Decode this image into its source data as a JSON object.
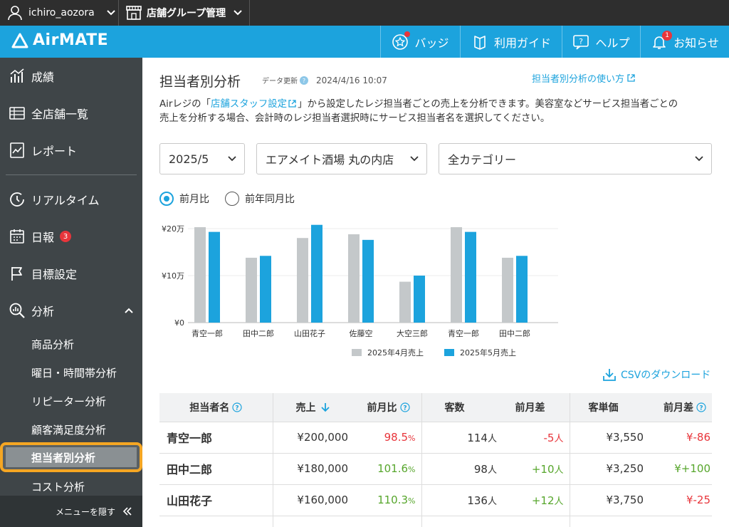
{
  "topbar": {
    "username": "ichiro_aozora",
    "store_group": "店舗グループ管理"
  },
  "header": {
    "logo": "AirMATE",
    "nav": [
      {
        "label": "バッジ",
        "icon": "badge-star-icon"
      },
      {
        "label": "利用ガイド",
        "icon": "guide-book-icon"
      },
      {
        "label": "ヘルプ",
        "icon": "help-icon"
      },
      {
        "label": "お知らせ",
        "icon": "bell-icon",
        "badge": "1"
      }
    ]
  },
  "sidebar": {
    "items": [
      {
        "label": "成績",
        "icon": "performance-chart-icon"
      },
      {
        "label": "全店舗一覧",
        "icon": "list-icon"
      },
      {
        "label": "レポート",
        "icon": "report-icon"
      },
      {
        "label": "リアルタイム",
        "icon": "clock-icon"
      },
      {
        "label": "日報",
        "icon": "calendar-icon",
        "badge": "3"
      },
      {
        "label": "目標設定",
        "icon": "flag-icon"
      },
      {
        "label": "分析",
        "icon": "analysis-icon"
      }
    ],
    "sub_items": [
      "商品分析",
      "曜日・時間帯分析",
      "リピーター分析",
      "顧客満足度分析",
      "担当者別分析",
      "コスト分析"
    ],
    "active_sub": "担当者別分析",
    "hide_menu": "メニューを隠す"
  },
  "page": {
    "title": "担当者別分析",
    "updated_label": "データ更新",
    "updated_time": "2024/4/16 10:07",
    "howto_link": "担当者別分析の使い方",
    "desc_prefix": "Airレジの「",
    "desc_link": "店舗スタッフ設定",
    "desc_line1_suffix": "」から設定したレジ担当者ごとの売上を分析できます。美容室などサービス担当者ごとの",
    "desc_line2": "売上を分析する場合、会計時のレジ担当者選択時にサービス担当者名を選択してください。"
  },
  "filters": {
    "month": "2025/5",
    "store": "エアメイト酒場 丸の内店",
    "category": "全カテゴリー"
  },
  "radios": {
    "option1": "前月比",
    "option2": "前年同月比",
    "selected": "前月比"
  },
  "chart_data": {
    "type": "bar",
    "categories": [
      "青空一郎",
      "田中二郎",
      "山田花子",
      "佐藤空",
      "大空三郎",
      "青空一郎",
      "田中二郎"
    ],
    "series": [
      {
        "name": "2025年4月売上",
        "values": [
          203000,
          138000,
          180000,
          188000,
          87000,
          203000,
          138000
        ],
        "color": "#c4c8ca"
      },
      {
        "name": "2025年5月売上",
        "values": [
          193000,
          142000,
          208000,
          176000,
          100000,
          193000,
          142000
        ],
        "color": "#1ca3dd"
      }
    ],
    "ylim": [
      0,
      200000
    ],
    "yticks": [
      "¥0",
      "¥10万",
      "¥20万"
    ]
  },
  "csv_link": "CSVのダウンロード",
  "table": {
    "headers": [
      "担当者名",
      "売上",
      "前月比",
      "客数",
      "前月差",
      "客単価",
      "前月差"
    ],
    "rows": [
      {
        "name": "青空一郎",
        "sales": "¥200,000",
        "ratio": "98.5",
        "customers": "114",
        "cust_diff": "-5",
        "unit": "¥3,550",
        "unit_diff": "¥-86"
      },
      {
        "name": "田中二郎",
        "sales": "¥180,000",
        "ratio": "101.6",
        "customers": "98",
        "cust_diff": "+10",
        "unit": "¥3,250",
        "unit_diff": "¥+100"
      },
      {
        "name": "山田花子",
        "sales": "¥160,000",
        "ratio": "110.3",
        "customers": "136",
        "cust_diff": "+12",
        "unit": "¥3,750",
        "unit_diff": "¥-25"
      }
    ],
    "pct_unit": "%",
    "person_unit": "人"
  }
}
